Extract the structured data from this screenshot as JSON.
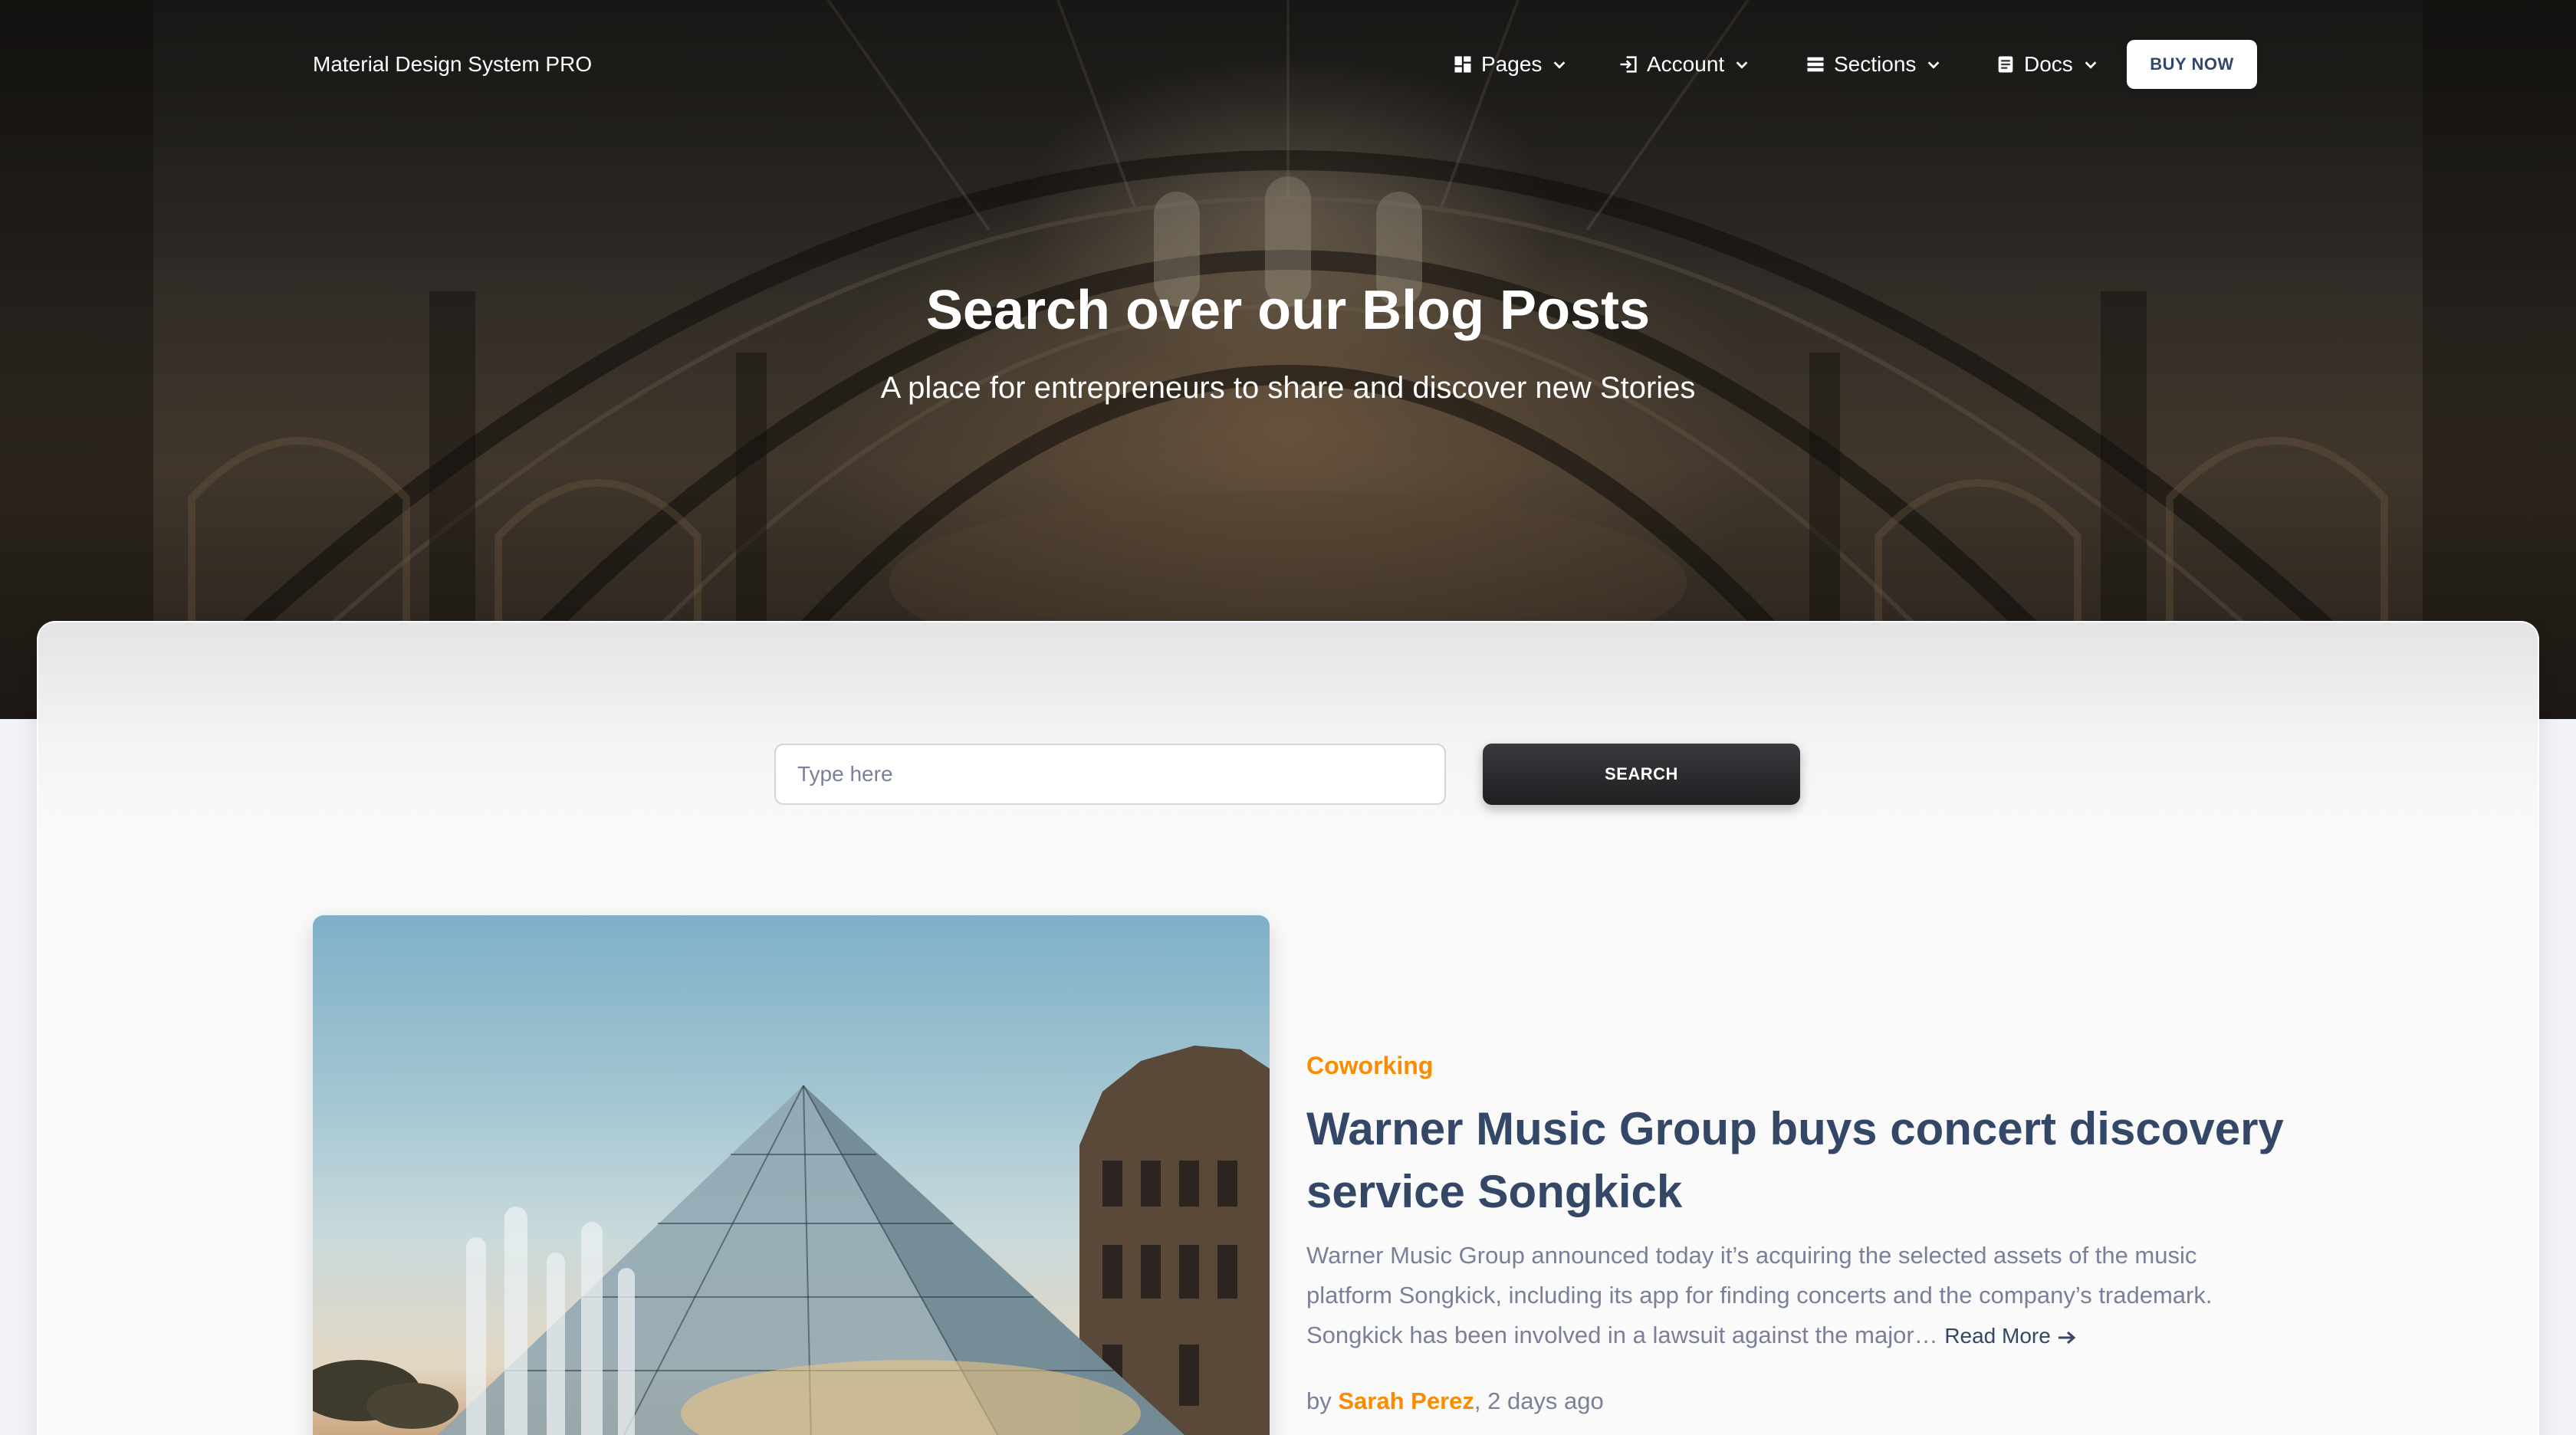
{
  "nav": {
    "brand": "Material Design System PRO",
    "items": [
      {
        "label": "Pages",
        "icon": "dashboard-icon"
      },
      {
        "label": "Account",
        "icon": "login-icon"
      },
      {
        "label": "Sections",
        "icon": "view-list-icon"
      },
      {
        "label": "Docs",
        "icon": "article-icon"
      }
    ],
    "buy_label": "BUY NOW"
  },
  "hero": {
    "title": "Search over our Blog Posts",
    "subtitle": "A place for entrepreneurs to share and discover new Stories"
  },
  "search": {
    "placeholder": "Type here",
    "button_label": "SEARCH"
  },
  "post": {
    "category": "Coworking",
    "title": "Warner Music Group buys concert discovery service Songkick",
    "excerpt": "Warner Music Group announced today it’s acquiring the selected assets of the music platform Songkick, including its app for finding concerts and the company’s trademark. Songkick has been involved in a lawsuit against the major…",
    "read_more": "Read More",
    "by": "by",
    "author": "Sarah Perez",
    "time": ", 2 days ago"
  },
  "colors": {
    "accent": "#fb8c00",
    "heading": "#344767",
    "muted": "#7b809a"
  }
}
